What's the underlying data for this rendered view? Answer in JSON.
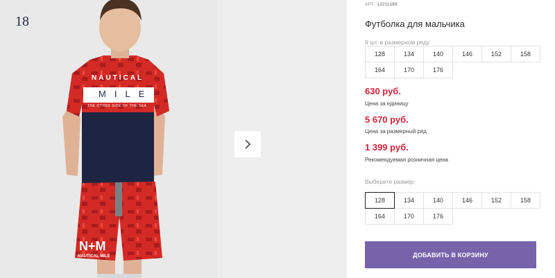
{
  "gallery": {
    "photo_number": "18",
    "shirt_text_top": "NAUTICAL",
    "shirt_text_band": "MILE",
    "shirt_subtext": "THE OTHER SIDE OF THE SEA",
    "shorts_logo": "N+M",
    "shorts_text": "NAUTICAL MILE"
  },
  "product": {
    "art_label": "АРТ.",
    "art_number": "12211189",
    "title": "Футболка для мальчика",
    "pieces_in_row": "9 шт. в размерном ряду",
    "row_sizes": [
      "128",
      "134",
      "140",
      "146",
      "152",
      "158",
      "164",
      "170",
      "176"
    ],
    "prices": [
      {
        "value": "630 руб.",
        "note": "Цена за единицу"
      },
      {
        "value": "5 670 руб.",
        "note": "Цена за размерный ряд"
      },
      {
        "value": "1 399 руб.",
        "note": "Рекомендуемая розничная цена"
      }
    ],
    "select_size_label": "Выберите размер:",
    "select_sizes": [
      "128",
      "134",
      "140",
      "146",
      "152",
      "158",
      "164",
      "170",
      "176"
    ],
    "selected_size": "128",
    "add_to_cart": "ДОБАВИТЬ В КОРЗИНУ"
  },
  "colors": {
    "price": "#d0243b",
    "button": "#7763aa",
    "shirt_navy": "#1e2542",
    "shirt_red": "#d42a25"
  },
  "icons": {
    "next": "chevron-right-icon"
  }
}
